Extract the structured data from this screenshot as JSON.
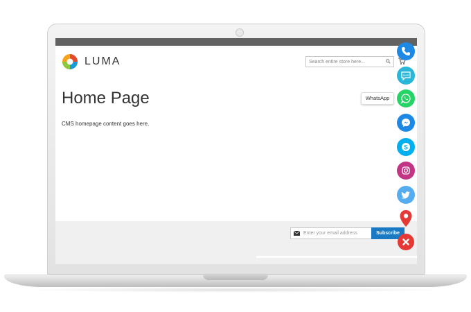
{
  "header": {
    "brand": "LUMA",
    "search": {
      "placeholder": "Search entire store here..."
    }
  },
  "main": {
    "title": "Home Page",
    "content": "CMS homepage content goes here."
  },
  "tooltip": {
    "whatsapp": "WhatsApp"
  },
  "footer": {
    "email_placeholder": "Enter your email address",
    "subscribe_label": "Subscribe"
  },
  "social_buttons": [
    {
      "icon": "phone-icon",
      "color": "#1e88e5"
    },
    {
      "icon": "sms-icon",
      "color": "#29b6d8"
    },
    {
      "icon": "whatsapp-icon",
      "color": "#25d366"
    },
    {
      "icon": "messenger-icon",
      "color": "#1e88e5"
    },
    {
      "icon": "skype-icon",
      "color": "#00aff0"
    },
    {
      "icon": "instagram-icon",
      "color": "#c13584"
    },
    {
      "icon": "twitter-icon",
      "color": "#55acee"
    },
    {
      "icon": "map-pin-icon",
      "color": "#e53935"
    },
    {
      "icon": "close-icon",
      "color": "#e53935"
    }
  ]
}
